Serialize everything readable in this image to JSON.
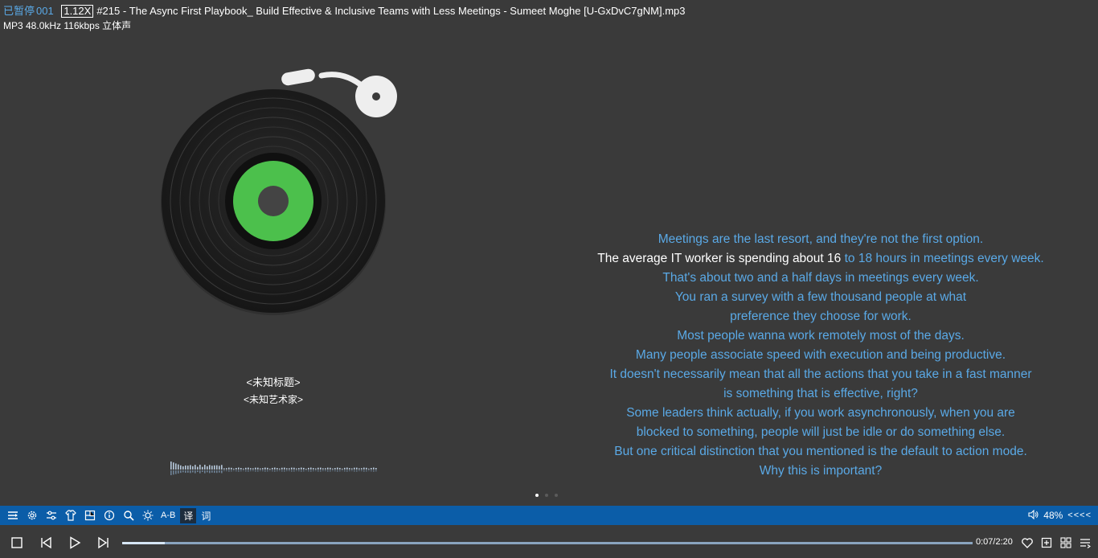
{
  "header": {
    "status": "已暂停",
    "track_number": "001",
    "speed": "1.12X",
    "filename": "#215 - The Async First Playbook_ Build Effective & Inclusive Teams with Less Meetings - Sumeet Moghe [U-GxDvC7gNM].mp3",
    "format_info": "MP3 48.0kHz 116kbps 立体声"
  },
  "track": {
    "title": "<未知标题>",
    "artist": "<未知艺术家>"
  },
  "lyrics": {
    "line1": "Meetings are the last resort, and they're not the first option.",
    "line2_sung": "The average IT worker is spending about 16",
    "line2_rest": " to 18 hours in meetings every week.",
    "line3": "That's about two and a half days in meetings every week.",
    "line4": "You ran a survey with a few thousand people at what",
    "line5": "preference they choose for work.",
    "line6": "Most people wanna work remotely most of the days.",
    "line7": "Many people associate speed with execution and being productive.",
    "line8": "It doesn't necessarily mean that all the actions that you take in a fast manner",
    "line9": "is something that is effective, right?",
    "line10": "Some leaders think actually, if you work asynchronously, when you are",
    "line11": "blocked to something, people will just be idle or do something else.",
    "line12": "But one critical distinction that you mentioned is the default to action mode.",
    "line13": "Why this is important?"
  },
  "toolbar": {
    "ab_label": "A-B",
    "translate_label": "译",
    "lyrics_label": "词",
    "volume": "48%",
    "arrows": "<<<<"
  },
  "playback": {
    "time": "0:07/2:20",
    "progress": 0.05
  },
  "colors": {
    "background": "#3a3a3a",
    "accent_blue": "#5aa9e6",
    "toolbar_blue": "#0b5da8",
    "vinyl_label_green": "#4cc04c"
  },
  "icons": [
    "playlist-icon",
    "settings-icon",
    "equalizer-icon",
    "skin-icon",
    "mini-mode-icon",
    "info-icon",
    "search-icon",
    "brightness-icon",
    "volume-icon",
    "stop-icon",
    "previous-icon",
    "play-icon",
    "next-icon",
    "favorite-icon",
    "add-icon",
    "grid-icon",
    "menu-icon"
  ]
}
